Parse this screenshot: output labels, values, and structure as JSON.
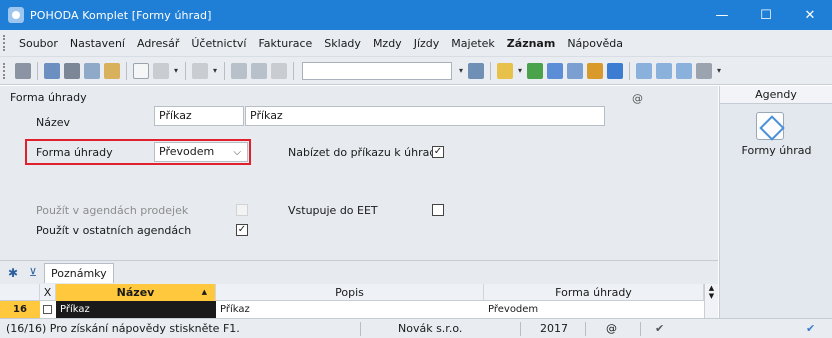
{
  "window": {
    "title": "POHODA Komplet  [Formy úhrad]",
    "controls": [
      "—",
      "☐",
      "✕"
    ]
  },
  "menu": {
    "items": [
      "Soubor",
      "Nastavení",
      "Adresář",
      "Účetnictví",
      "Fakturace",
      "Sklady",
      "Mzdy",
      "Jízdy",
      "Majetek",
      "Záznam",
      "Nápověda"
    ],
    "bold_item": "Záznam"
  },
  "form": {
    "title": "Forma úhrady",
    "at_symbol": "@",
    "nazev_label": "Název",
    "nazev_short_value": "Příkaz",
    "nazev_long_value": "Příkaz",
    "forma_label": "Forma úhrady",
    "forma_value": "Převodem",
    "nabizet_label": "Nabízet do příkazu k úhradě",
    "nabizet_checked": "✓",
    "pouzit_prodej_label": "Použít v agendách prodejek",
    "eet_label": "Vstupuje do EET",
    "pouzit_ostatni_label": "Použít v ostatních agendách",
    "pouzit_ostatni_checked": "✓"
  },
  "tabs": {
    "star": "✱",
    "filter": "⊻",
    "notes_label": "Poznámky"
  },
  "grid": {
    "columns": [
      "X",
      "Název",
      "Popis",
      "Forma úhrady"
    ],
    "sort_indicator": "▲",
    "row": {
      "number": "16",
      "name": "Příkaz",
      "popis": "Příkaz",
      "forma": "Převodem"
    }
  },
  "agendy": {
    "header": "Agendy",
    "item_label": "Formy úhrad"
  },
  "status": {
    "help": "(16/16) Pro získání nápovědy stiskněte F1.",
    "company": "Novák s.r.o.",
    "year": "2017",
    "at": "@",
    "check": "✔"
  },
  "colors": {
    "titlebar": "#1f7fd6",
    "highlight": "#e0202a",
    "sorted_column": "#ffc83d"
  }
}
